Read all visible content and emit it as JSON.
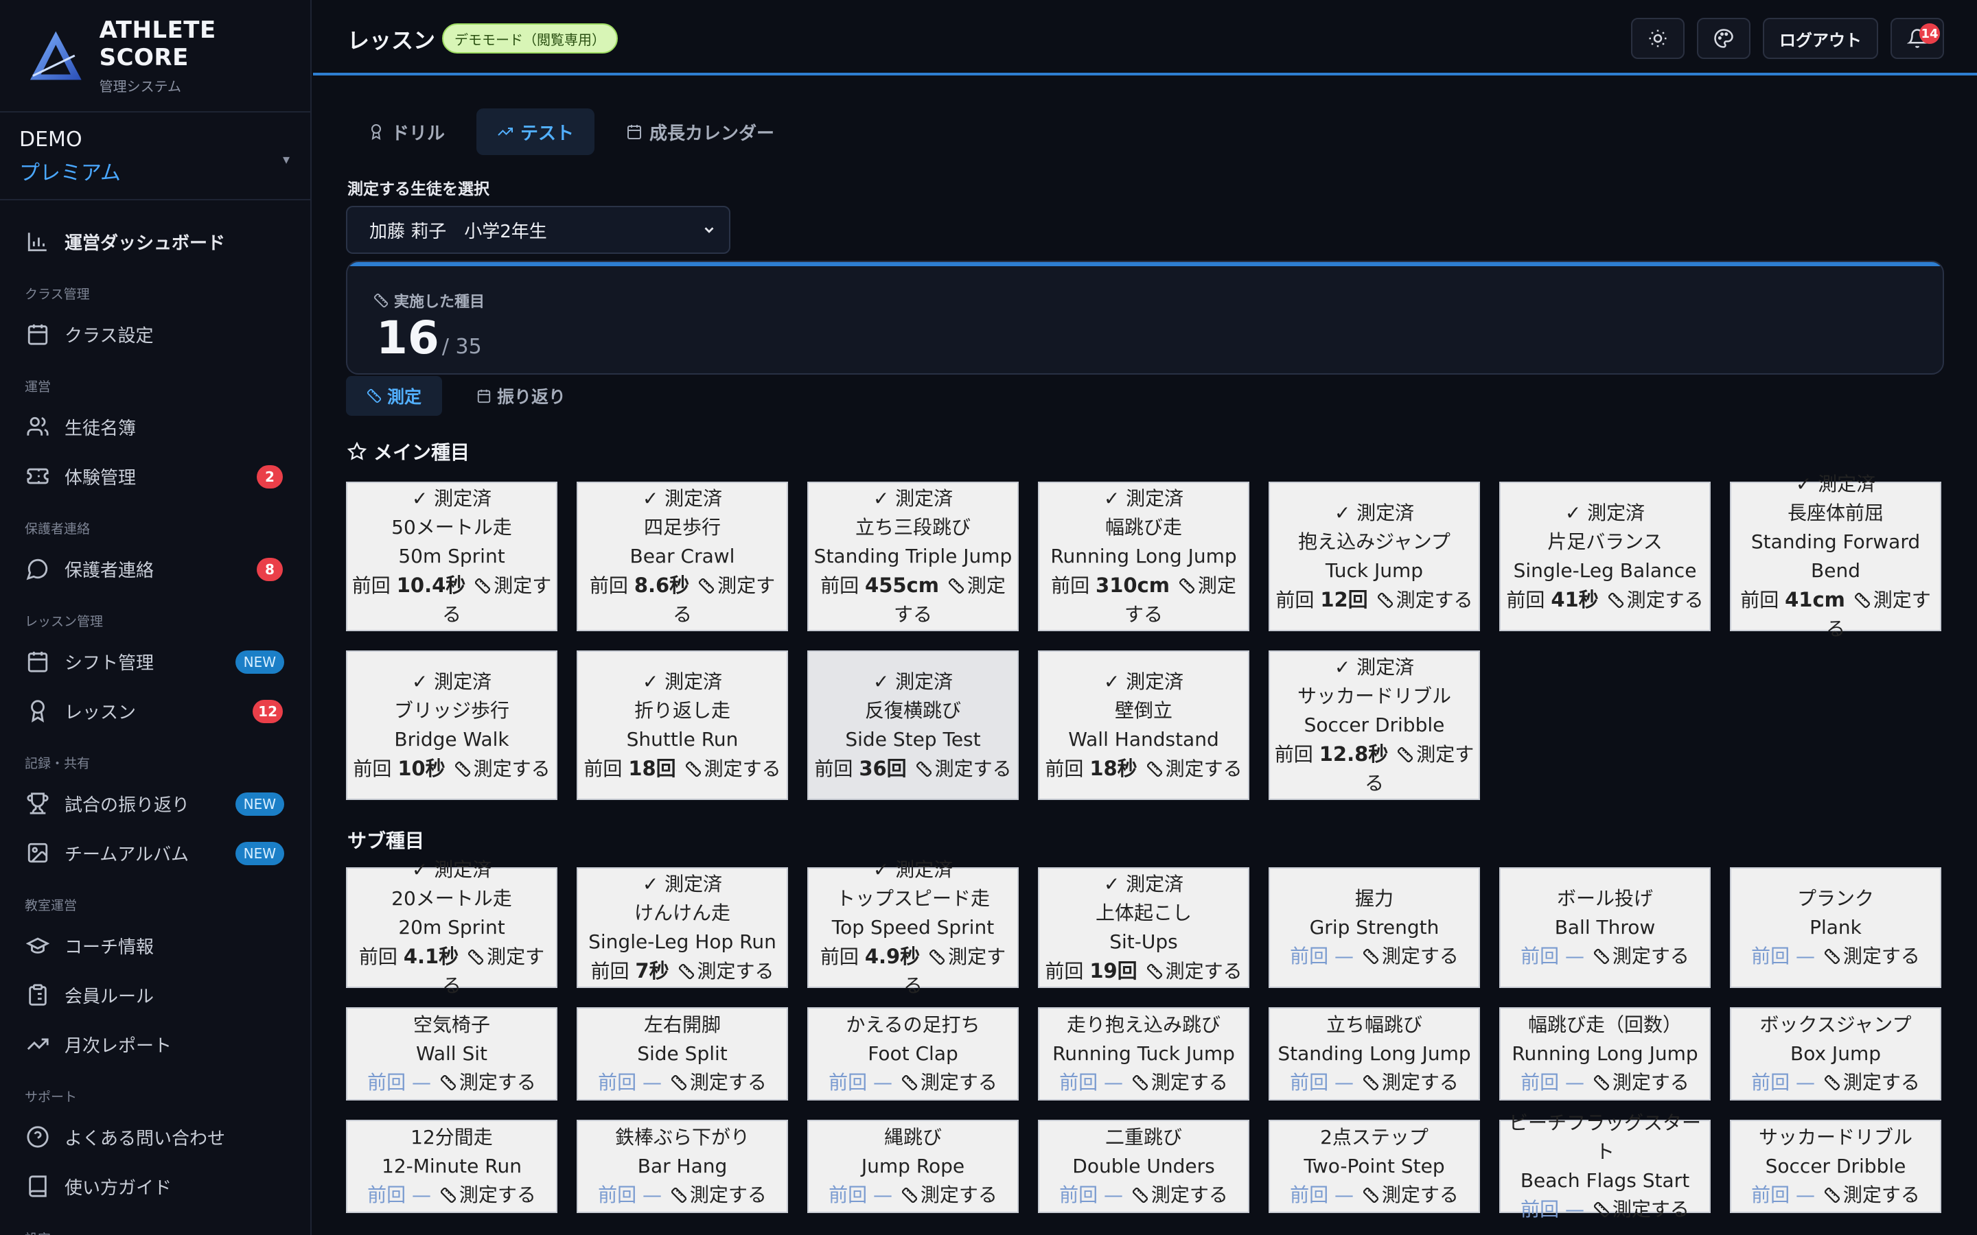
{
  "brand": {
    "name": "ATHLETE SCORE",
    "subtitle": "管理システム"
  },
  "plan": {
    "org": "DEMO",
    "tier": "プレミアム"
  },
  "sidebar": {
    "dashboard": "運営ダッシュボード",
    "sections": [
      {
        "title": "クラス管理",
        "items": [
          {
            "label": "クラス設定",
            "icon": "calendar-icon"
          }
        ]
      },
      {
        "title": "運営",
        "items": [
          {
            "label": "生徒名簿",
            "icon": "users-icon"
          },
          {
            "label": "体験管理",
            "icon": "ticket-icon",
            "badge": "2"
          }
        ]
      },
      {
        "title": "保護者連絡",
        "items": [
          {
            "label": "保護者連絡",
            "icon": "chat-icon",
            "badge": "8"
          }
        ]
      },
      {
        "title": "レッスン管理",
        "items": [
          {
            "label": "シフト管理",
            "icon": "calendar-grid-icon",
            "new": "NEW"
          },
          {
            "label": "レッスン",
            "icon": "award-icon",
            "badge": "12"
          }
        ]
      },
      {
        "title": "記録・共有",
        "items": [
          {
            "label": "試合の振り返り",
            "icon": "trophy-icon",
            "new": "NEW"
          },
          {
            "label": "チームアルバム",
            "icon": "image-icon",
            "new": "NEW"
          }
        ]
      },
      {
        "title": "教室運営",
        "items": [
          {
            "label": "コーチ情報",
            "icon": "graduation-cap-icon"
          },
          {
            "label": "会員ルール",
            "icon": "clipboard-icon"
          },
          {
            "label": "月次レポート",
            "icon": "trending-up-icon"
          }
        ]
      },
      {
        "title": "サポート",
        "items": [
          {
            "label": "よくある問い合わせ",
            "icon": "help-circle-icon"
          },
          {
            "label": "使い方ガイド",
            "icon": "book-icon"
          }
        ]
      },
      {
        "title": "設定",
        "items": []
      }
    ]
  },
  "header": {
    "title": "レッスン",
    "demo_badge": "デモモード（閲覧専用）",
    "logout": "ログアウト",
    "notification_count": "14"
  },
  "tabs": [
    {
      "label": "ドリル"
    },
    {
      "label": "テスト",
      "active": true
    },
    {
      "label": "成長カレンダー"
    }
  ],
  "select_label": "測定する生徒を選択",
  "student": "加藤 莉子　小学2年生",
  "stat": {
    "label": "実施した種目",
    "value": "16",
    "total": "/ 35"
  },
  "subtabs": [
    {
      "label": "測定",
      "active": true
    },
    {
      "label": "振り返り"
    }
  ],
  "main_title": "メイン種目",
  "sub_title": "サブ種目",
  "measured_label": "✓ 測定済",
  "prev_label": "前回",
  "measure_action": "測定する",
  "empty_value": "—",
  "main_events": [
    {
      "ja": "50メートル走",
      "en": "50m Sprint",
      "prev": "10.4秒"
    },
    {
      "ja": "四足歩行",
      "en": "Bear Crawl",
      "prev": "8.6秒"
    },
    {
      "ja": "立ち三段跳び",
      "en": "Standing Triple Jump",
      "prev": "455cm"
    },
    {
      "ja": "幅跳び走",
      "en": "Running Long Jump",
      "prev": "310cm"
    },
    {
      "ja": "抱え込みジャンプ",
      "en": "Tuck Jump",
      "prev": "12回"
    },
    {
      "ja": "片足バランス",
      "en": "Single-Leg Balance",
      "prev": "41秒"
    },
    {
      "ja": "長座体前屈",
      "en": "Standing Forward Bend",
      "prev": "41cm"
    },
    {
      "ja": "ブリッジ歩行",
      "en": "Bridge Walk",
      "prev": "10秒"
    },
    {
      "ja": "折り返し走",
      "en": "Shuttle Run",
      "prev": "18回"
    },
    {
      "ja": "反復横跳び",
      "en": "Side Step Test",
      "prev": "36回",
      "highlight": true
    },
    {
      "ja": "壁倒立",
      "en": "Wall Handstand",
      "prev": "18秒"
    },
    {
      "ja": "サッカードリブル",
      "en": "Soccer Dribble",
      "prev": "12.8秒"
    }
  ],
  "sub_events": [
    {
      "ja": "20メートル走",
      "en": "20m Sprint",
      "prev": "4.1秒"
    },
    {
      "ja": "けんけん走",
      "en": "Single-Leg Hop Run",
      "prev": "7秒"
    },
    {
      "ja": "トップスピード走",
      "en": "Top Speed Sprint",
      "prev": "4.9秒"
    },
    {
      "ja": "上体起こし",
      "en": "Sit-Ups",
      "prev": "19回"
    },
    {
      "ja": "握力",
      "en": "Grip Strength"
    },
    {
      "ja": "ボール投げ",
      "en": "Ball Throw"
    },
    {
      "ja": "プランク",
      "en": "Plank"
    },
    {
      "ja": "空気椅子",
      "en": "Wall Sit"
    },
    {
      "ja": "左右開脚",
      "en": "Side Split"
    },
    {
      "ja": "かえるの足打ち",
      "en": "Foot Clap"
    },
    {
      "ja": "走り抱え込み跳び",
      "en": "Running Tuck Jump"
    },
    {
      "ja": "立ち幅跳び",
      "en": "Standing Long Jump"
    },
    {
      "ja": "幅跳び走（回数）",
      "en": "Running Long Jump"
    },
    {
      "ja": "ボックスジャンプ",
      "en": "Box Jump"
    },
    {
      "ja": "12分間走",
      "en": "12-Minute Run"
    },
    {
      "ja": "鉄棒ぶら下がり",
      "en": "Bar Hang"
    },
    {
      "ja": "縄跳び",
      "en": "Jump Rope"
    },
    {
      "ja": "二重跳び",
      "en": "Double Unders"
    },
    {
      "ja": "2点ステップ",
      "en": "Two-Point Step"
    },
    {
      "ja": "ビーチフラッグスタート",
      "en": "Beach Flags Start"
    },
    {
      "ja": "サッカードリブル",
      "en": "Soccer Dribble"
    }
  ],
  "colors": {
    "accent": "#2e7ed1",
    "badge_red": "#ea3f49",
    "badge_new": "#1b7fc7",
    "card_bg": "#f0f0f0"
  }
}
